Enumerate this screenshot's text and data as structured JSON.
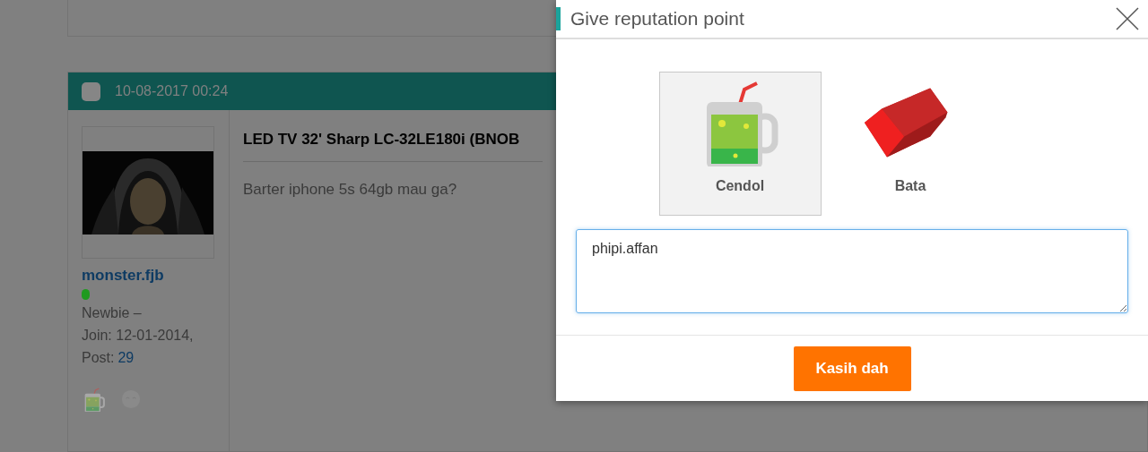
{
  "post": {
    "checked": false,
    "date": "10-08-2017 00:24",
    "title": "LED TV 32' Sharp LC-32LE180i (BNOB",
    "body": "Barter iphone 5s 64gb mau ga?",
    "user": {
      "name": "monster.fjb",
      "status": {
        "color": "#1f9a1f"
      },
      "rank": "Newbie –",
      "join": "Join: 12-01-2014,",
      "post_label": "Post:",
      "post_count": "29"
    }
  },
  "dialog": {
    "title": "Give reputation point",
    "options": [
      {
        "label": "Cendol",
        "kind": "cendol",
        "selected": true
      },
      {
        "label": "Bata",
        "kind": "bata",
        "selected": false
      }
    ],
    "message": {
      "value": "phipi.affan"
    },
    "submit": "Kasih dah"
  }
}
